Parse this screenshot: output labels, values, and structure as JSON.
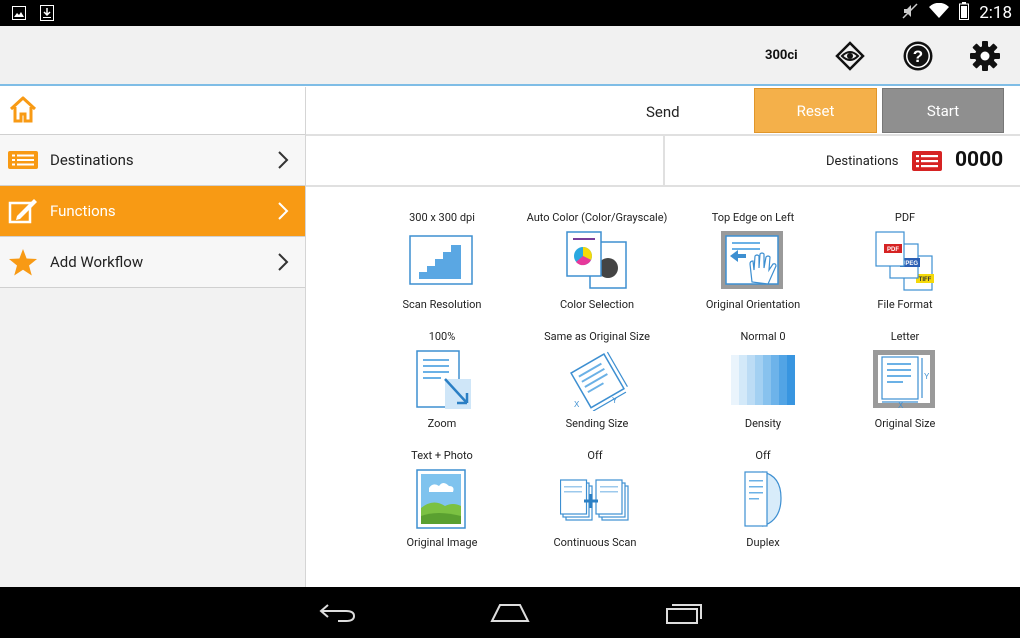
{
  "statusbar": {
    "time": "2:18"
  },
  "header": {
    "model": "300ci"
  },
  "sidebar": {
    "items": [
      {
        "label": "Destinations",
        "icon": "list-icon"
      },
      {
        "label": "Functions",
        "icon": "pen-box-icon",
        "active": true
      },
      {
        "label": "Add Workflow",
        "icon": "star-icon"
      }
    ]
  },
  "toolbar": {
    "send_label": "Send",
    "reset_label": "Reset",
    "start_label": "Start"
  },
  "destinations": {
    "label": "Destinations",
    "count": "0000"
  },
  "functions": [
    {
      "value": "300 x 300 dpi",
      "name": "Scan Resolution",
      "icon": "stairs-icon"
    },
    {
      "value": "Auto Color (Color/Grayscale)",
      "name": "Color Selection",
      "icon": "color-pages-icon"
    },
    {
      "value": "Top Edge on Left",
      "name": "Original Orientation",
      "icon": "hand-page-icon"
    },
    {
      "value": "PDF",
      "name": "File Format",
      "icon": "file-formats-icon"
    },
    {
      "value": "100%",
      "name": "Zoom",
      "icon": "zoom-page-icon"
    },
    {
      "value": "Same as Original Size",
      "name": "Sending Size",
      "icon": "rotated-page-icon"
    },
    {
      "value": "Normal 0",
      "name": "Density",
      "icon": "density-gradient-icon"
    },
    {
      "value": "Letter",
      "name": "Original Size",
      "icon": "page-xy-icon"
    },
    {
      "value": "Text + Photo",
      "name": "Original Image",
      "icon": "landscape-photo-icon"
    },
    {
      "value": "Off",
      "name": "Continuous Scan",
      "icon": "stacked-pages-icon"
    },
    {
      "value": "Off",
      "name": "Duplex",
      "icon": "duplex-page-icon"
    }
  ],
  "colors": {
    "accent": "#f89a14",
    "reset": "#f4b04a",
    "start": "#8f8f8f",
    "header_line": "#7fbde6",
    "icon_blue": "#4a9fdc"
  }
}
